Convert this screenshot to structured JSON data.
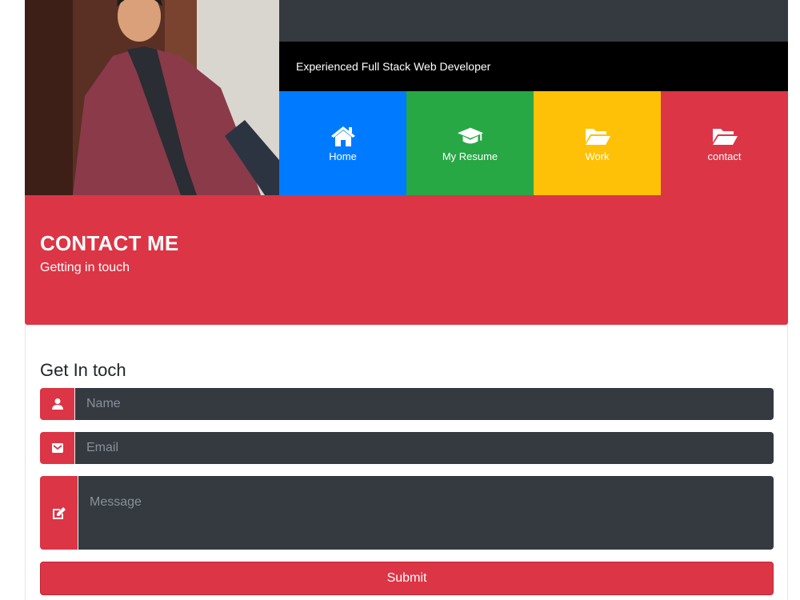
{
  "header": {
    "tagline": "Experienced Full Stack Web Developer"
  },
  "nav": {
    "items": [
      {
        "label": "Home",
        "icon": "home-icon",
        "color": "#007bff"
      },
      {
        "label": "My Resume",
        "icon": "graduation-cap-icon",
        "color": "#28a745"
      },
      {
        "label": "Work",
        "icon": "folder-open-icon",
        "color": "#ffc107"
      },
      {
        "label": "contact",
        "icon": "folder-open-icon",
        "color": "#dc3545"
      }
    ]
  },
  "banner": {
    "title": "CONTACT ME",
    "subtitle": "Getting in touch",
    "color": "#dc3545"
  },
  "form": {
    "heading": "Get In toch",
    "name_placeholder": "Name",
    "email_placeholder": "Email",
    "message_placeholder": "Message",
    "submit_label": "Submit",
    "field_background": "#343a40"
  }
}
